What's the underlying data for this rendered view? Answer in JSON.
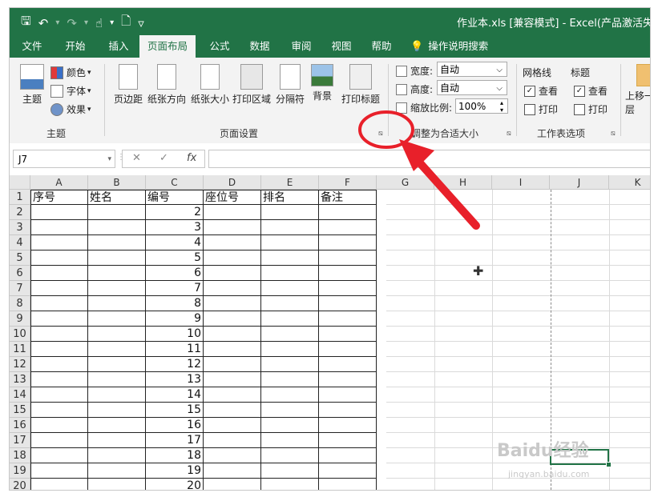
{
  "titlebar": {
    "qat": {
      "save": "🖫",
      "undo": "↶",
      "redo": "↷",
      "touch": "☝",
      "preview": "🗋",
      "customize": "▿"
    },
    "title": "作业本.xls  [兼容模式]  -  Excel(产品激活失败)"
  },
  "tabs": [
    "文件",
    "开始",
    "插入",
    "页面布局",
    "公式",
    "数据",
    "审阅",
    "视图",
    "帮助"
  ],
  "tell_me": "操作说明搜索",
  "ribbon": {
    "themes": {
      "theme_label": "主题",
      "colors": "颜色",
      "fonts": "字体",
      "effects": "效果",
      "group": "主题"
    },
    "page_setup": {
      "margins": "页边距",
      "orientation": "纸张方向",
      "size": "纸张大小",
      "print_area": "打印区域",
      "breaks": "分隔符",
      "background": "背景",
      "print_titles": "打印标题",
      "group": "页面设置"
    },
    "scale": {
      "width_label": "宽度:",
      "width_value": "自动",
      "height_label": "高度:",
      "height_value": "自动",
      "scale_label": "缩放比例:",
      "scale_value": "100%",
      "group": "调整为合适大小"
    },
    "sheet_options": {
      "gridlines": "网格线",
      "headings": "标题",
      "view": "查看",
      "print": "打印",
      "group": "工作表选项"
    },
    "arrange": {
      "bring_forward": "上移一层"
    }
  },
  "formula_bar": {
    "name_box": "J7",
    "cancel": "✕",
    "enter": "✓",
    "fx": "fx",
    "value": ""
  },
  "columns": [
    "A",
    "B",
    "C",
    "D",
    "E",
    "F",
    "G",
    "H",
    "I",
    "J",
    "K"
  ],
  "headers_row": [
    "序号",
    "姓名",
    "编号",
    "座位号",
    "排名",
    "备注"
  ],
  "rows": [
    "1",
    "2",
    "3",
    "4",
    "5",
    "6",
    "7",
    "8",
    "9",
    "10",
    "11",
    "12",
    "13",
    "14",
    "15",
    "16",
    "17",
    "18",
    "19",
    "20"
  ],
  "numbers": [
    "2",
    "3",
    "4",
    "5",
    "6",
    "7",
    "8",
    "9",
    "10",
    "11",
    "12",
    "13",
    "14",
    "15",
    "16",
    "17",
    "18",
    "19",
    "20"
  ],
  "watermark": {
    "text": "Baidu经验",
    "url": "jingyan.baidu.com"
  },
  "colors": {
    "accent": "#217346",
    "annotation": "#e8202a"
  }
}
